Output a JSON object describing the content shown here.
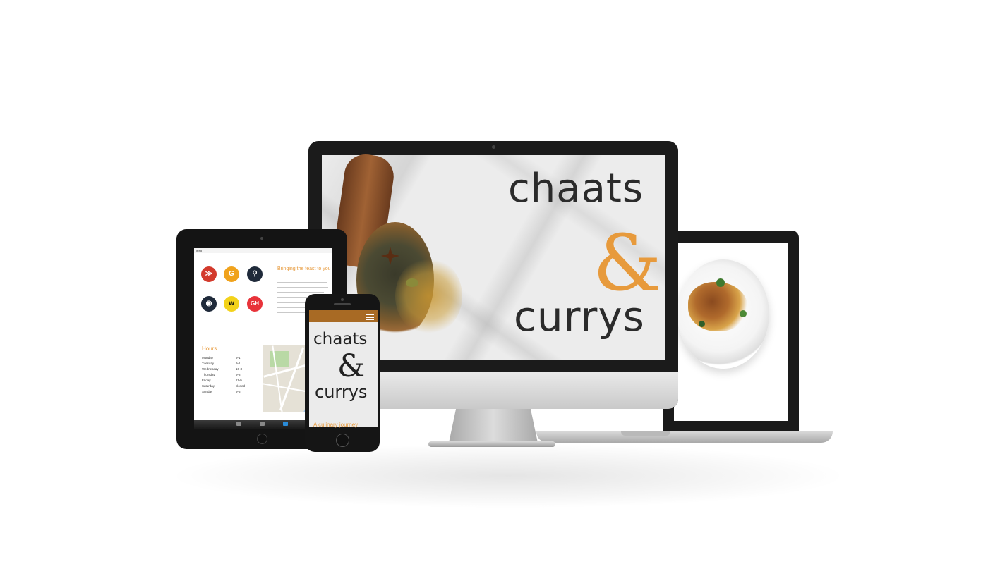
{
  "brand": {
    "word1": "chaats",
    "ampersand": "&",
    "word2": "currys",
    "accent_color": "#e79a3c",
    "text_color": "#2b2b2b"
  },
  "desktop": {
    "hero_images": [
      "spice-spoon",
      "marble-background"
    ]
  },
  "laptop": {
    "hero_image": "plated-dish"
  },
  "tablet": {
    "heading": "Bringing the feast to you",
    "delivery_partners": [
      {
        "icon": "delivery-wing-icon",
        "color": "#d33a2c",
        "label": ""
      },
      {
        "icon": "g-logo-icon",
        "color": "#f0a21c",
        "label": ""
      },
      {
        "icon": "cyclist-icon",
        "color": "#1f2a3a",
        "label": ""
      },
      {
        "icon": "pin-logo-icon",
        "color": "#1f2a3a",
        "label": ""
      },
      {
        "icon": "w-logo-icon",
        "color": "#f3d21a",
        "label": "w"
      },
      {
        "icon": "gh-logo-icon",
        "color": "#e8333a",
        "label": "GH"
      }
    ],
    "hours": {
      "title": "Hours",
      "rows": [
        {
          "day": "Monday",
          "time": "9-1"
        },
        {
          "day": "Tuesday",
          "time": "9-1"
        },
        {
          "day": "Wednesday",
          "time": "10-3"
        },
        {
          "day": "Thursday",
          "time": "9-8"
        },
        {
          "day": "Friday",
          "time": "11-9"
        },
        {
          "day": "Saturday",
          "time": "closed"
        },
        {
          "day": "Sunday",
          "time": "9-6"
        }
      ]
    },
    "status_left": "iPad",
    "status_center": ""
  },
  "phone": {
    "subheading": "A culinary journey",
    "menu_color": "#a86a24"
  }
}
